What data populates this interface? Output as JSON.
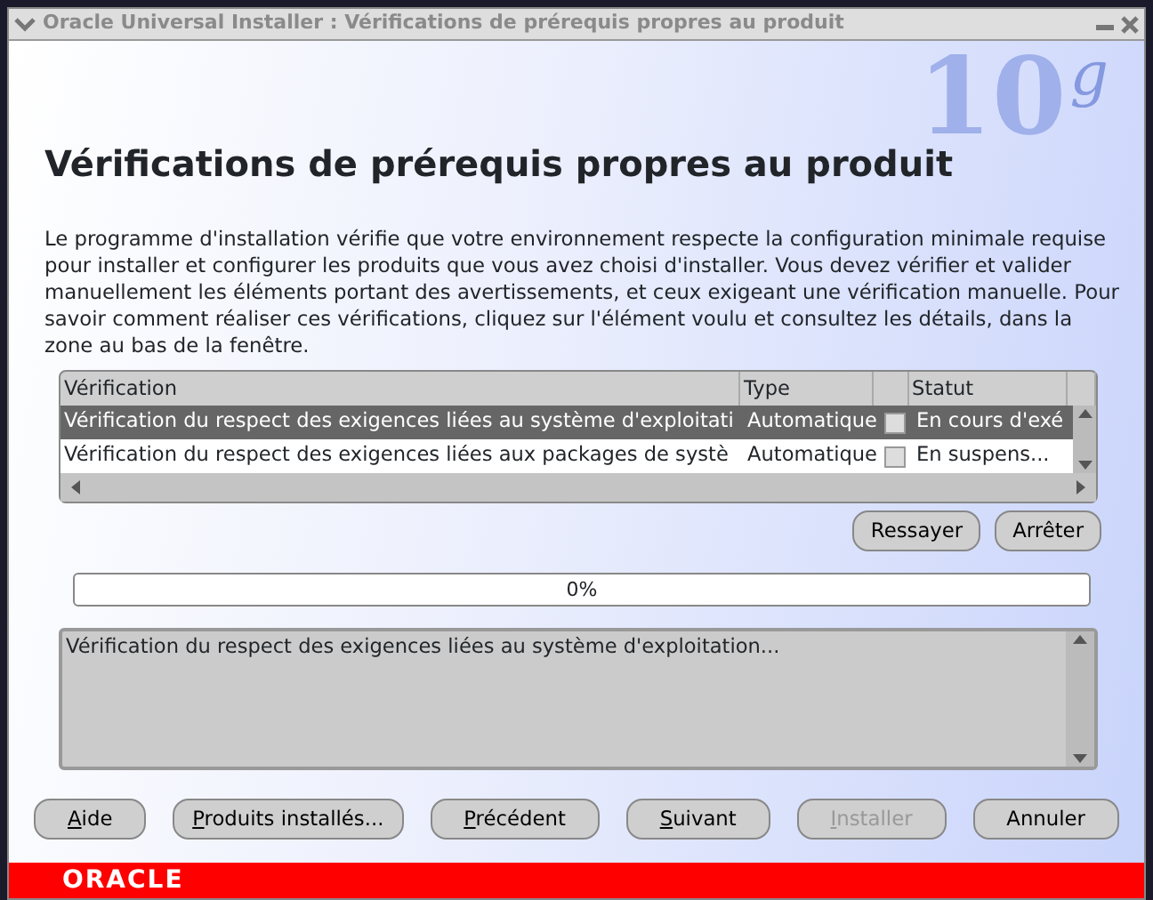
{
  "window": {
    "title": "Oracle Universal Installer : Vérifications de prérequis propres au produit"
  },
  "brand": {
    "number": "10",
    "letter": "g"
  },
  "heading": "Vérifications de prérequis propres au produit",
  "description": "Le programme d'installation vérifie que votre environnement respecte la configuration minimale requise pour installer et configurer les produits que vous avez choisi d'installer. Vous devez vérifier et valider manuellement les éléments portant des avertissements, et ceux exigeant une vérification manuelle. Pour savoir comment réaliser ces vérifications, cliquez sur l'élément voulu et consultez les détails, dans la zone au bas de la fenêtre.",
  "table": {
    "columns": [
      "Vérification",
      "Type",
      "Statut"
    ],
    "rows": [
      {
        "check": "Vérification du respect des exigences liées au système d'exploitati",
        "type": "Automatique",
        "checked": false,
        "status": "En cours d'exé",
        "selected": true
      },
      {
        "check": "Vérification du respect des exigences liées aux packages de systè",
        "type": "Automatique",
        "checked": false,
        "status": "En suspens...",
        "selected": false
      }
    ]
  },
  "table_buttons": [
    "Ressayer",
    "Arrêter"
  ],
  "progress": {
    "level": 0,
    "text": "0%"
  },
  "details": "Vérification du respect des exigences liées au système d'exploitation...",
  "buttons": [
    {
      "label": "Aide",
      "underline_first": true,
      "disabled": false
    },
    {
      "label": "Produits installés...",
      "underline_first": true,
      "disabled": false
    },
    {
      "label": "Précédent",
      "underline_first": true,
      "disabled": false
    },
    {
      "label": "Suivant",
      "underline_first": true,
      "disabled": false
    },
    {
      "label": "Installer",
      "underline_first": true,
      "disabled": true
    },
    {
      "label": "Annuler",
      "underline_first": false,
      "disabled": false
    }
  ],
  "footer_logo": "ORACLE"
}
